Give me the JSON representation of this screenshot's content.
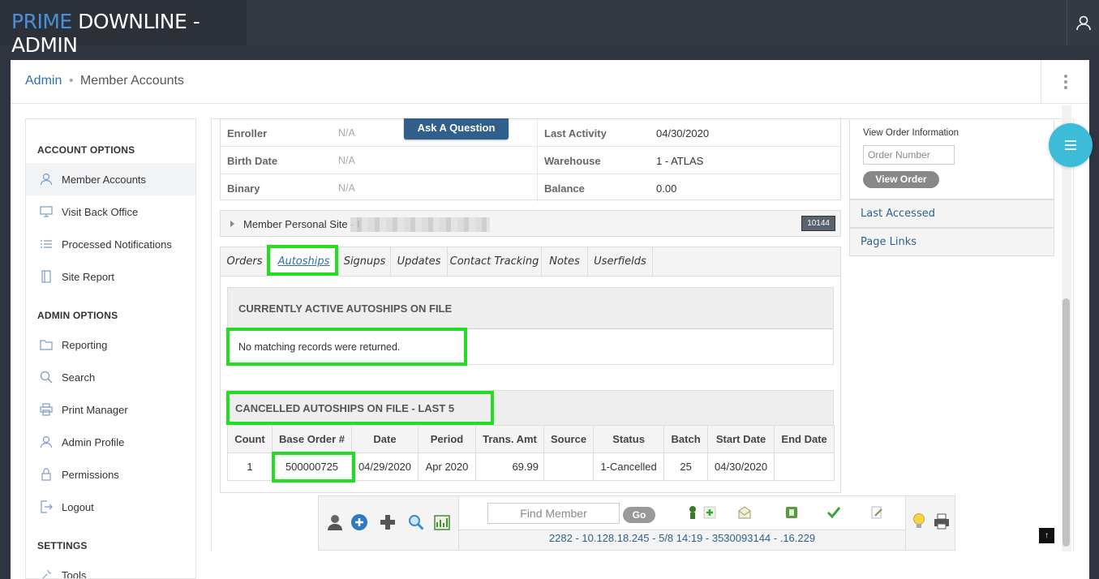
{
  "brand": {
    "part1": "PRIME",
    "part2": "DOWNLINE - ADMIN"
  },
  "breadcrumb": {
    "root": "Admin",
    "separator": "•",
    "current": "Member Accounts"
  },
  "sidebar": {
    "account_options_title": "ACCOUNT OPTIONS",
    "account_items": [
      {
        "label": "Member Accounts",
        "icon": "user-icon"
      },
      {
        "label": "Visit Back Office",
        "icon": "monitor-icon"
      },
      {
        "label": "Processed Notifications",
        "icon": "list-icon"
      },
      {
        "label": "Site Report",
        "icon": "notebook-icon"
      }
    ],
    "admin_options_title": "ADMIN OPTIONS",
    "admin_items": [
      {
        "label": "Reporting",
        "icon": "folder-icon"
      },
      {
        "label": "Search",
        "icon": "search-icon"
      },
      {
        "label": "Print Manager",
        "icon": "printer-icon"
      },
      {
        "label": "Admin Profile",
        "icon": "user-icon"
      },
      {
        "label": "Permissions",
        "icon": "lock-icon"
      },
      {
        "label": "Logout",
        "icon": "logout-icon"
      }
    ],
    "settings_title": "SETTINGS",
    "settings_items": [
      {
        "label": "Tools",
        "icon": "tools-icon"
      }
    ]
  },
  "member_info": {
    "rows": [
      {
        "label1": "Enroller",
        "value1": "N/A",
        "label2": "Last Activity",
        "value2": "04/30/2020"
      },
      {
        "label1": "Birth Date",
        "value1": "N/A",
        "label2": "Warehouse",
        "value2": "1 - ATLAS"
      },
      {
        "label1": "Binary",
        "value1": "N/A",
        "label2": "Balance",
        "value2": "0.00"
      }
    ],
    "ask_button": "Ask A Question"
  },
  "personal_site": {
    "label": "Member Personal Site - I",
    "badge": "10144"
  },
  "tabs": [
    "Orders",
    "Autoships",
    "Signups",
    "Updates",
    "Contact Tracking",
    "Notes",
    "Userfields"
  ],
  "active_tab": "Autoships",
  "active_autoships": {
    "title": "CURRENTLY ACTIVE AUTOSHIPS ON FILE",
    "empty_message": "No matching records were returned."
  },
  "cancelled_autoships": {
    "title": "CANCELLED AUTOSHIPS ON FILE - LAST 5",
    "columns": [
      "Count",
      "Base Order #",
      "Date",
      "Period",
      "Trans. Amt",
      "Source",
      "Status",
      "Batch",
      "Start Date",
      "End Date"
    ],
    "rows": [
      [
        "1",
        "500000725",
        "04/29/2020",
        "Apr 2020",
        "69.99",
        "",
        "1-Cancelled",
        "25",
        "04/30/2020",
        ""
      ]
    ]
  },
  "toolbar": {
    "find_placeholder": "Find Member",
    "go_label": "Go",
    "status_line": "2282 - 10.128.18.245 - 5/8 14:19 - 3530093144 - .16.229"
  },
  "right_panel": {
    "view_order_title": "View Order Information",
    "order_placeholder": "Order Number",
    "view_order_button": "View Order",
    "links": [
      "Last Accessed",
      "Page Links"
    ]
  },
  "back_to_top": "↑",
  "colors": {
    "highlight": "#22dd22",
    "accent": "#3cbcd9",
    "brand_blue": "#4a90d9"
  }
}
